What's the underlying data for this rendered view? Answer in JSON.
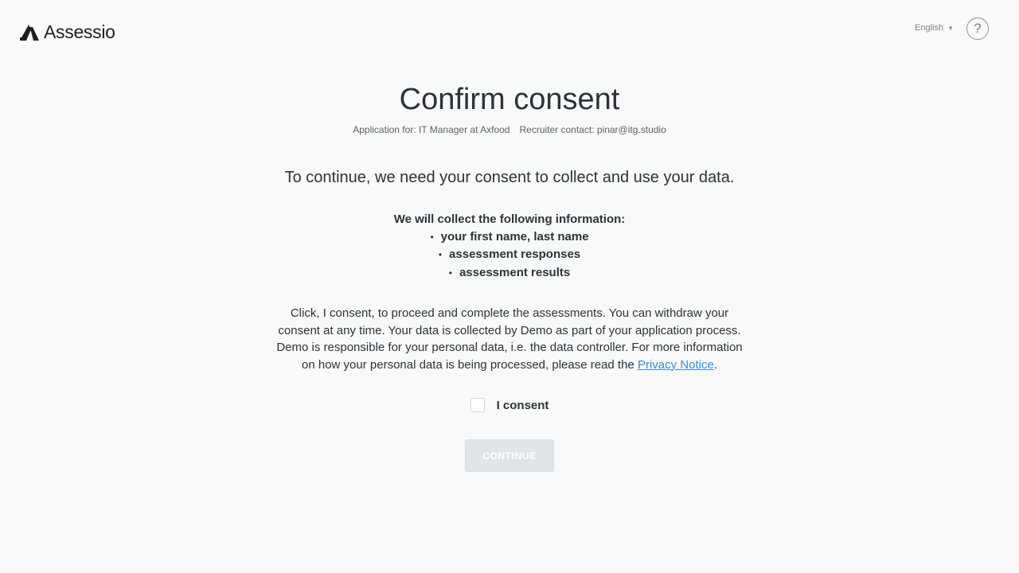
{
  "header": {
    "logo_text": "Assessio",
    "language": "English",
    "help_symbol": "?"
  },
  "main": {
    "title": "Confirm consent",
    "application_for": "Application for: IT Manager at Axfood",
    "recruiter_contact": "Recruiter contact: pinar@itg.studio",
    "lead": "To continue, we need your consent to collect and use your data.",
    "collect_heading": "We will collect the following information:",
    "collect_items": [
      "your first name, last name",
      "assessment responses",
      "assessment results"
    ],
    "description": "Click, I consent, to proceed and complete the assessments. You can withdraw your consent at any time. Your data is collected by Demo as part of your application process. Demo is responsible for your personal data, i.e. the data controller. For more information on how your personal data is being processed, please read the",
    "privacy_link": "Privacy Notice",
    "description_end": ".",
    "consent_label": "I consent",
    "continue_label": "CONTINUE"
  },
  "icons": {
    "logo": "assessio-logo-icon",
    "help": "help-icon",
    "language_chevron": "chevron-down-icon"
  },
  "colors": {
    "background": "#f8f9fa",
    "text": "#2d3338",
    "link": "#3b8bd6",
    "button_disabled": "#e1e4e9"
  }
}
